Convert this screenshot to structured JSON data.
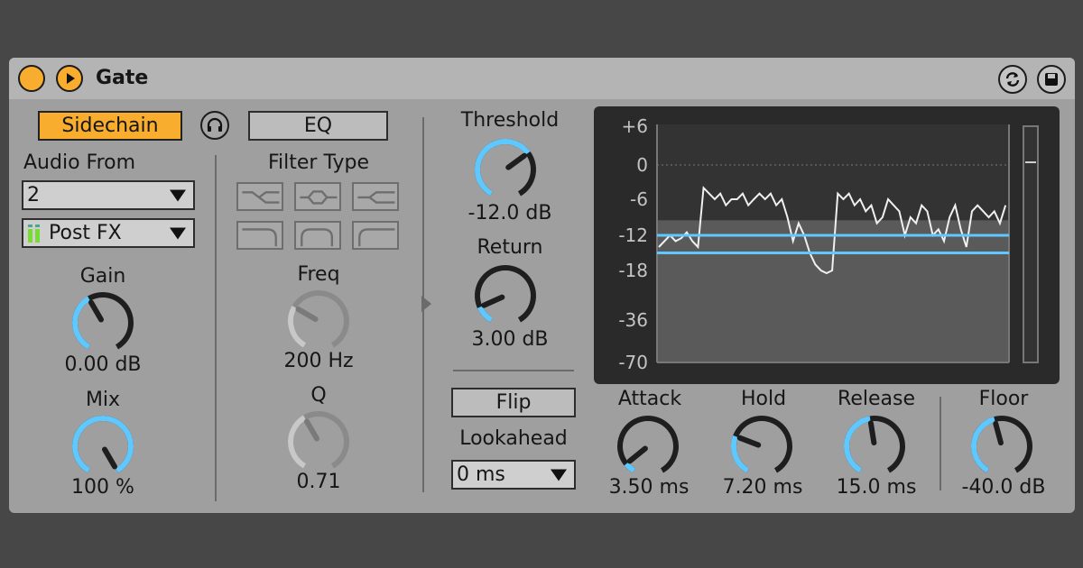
{
  "device": {
    "title": "Gate",
    "activator_icon": "power-circle",
    "play_icon": "play-triangle",
    "hot_swap_icon": "hot-swap-icon",
    "save_icon": "save-icon",
    "accent_color": "#f8ad2f",
    "knob_arc_color": "#5ec8ff"
  },
  "sidechain": {
    "toggle_label": "Sidechain",
    "listen_icon": "headphones-icon",
    "eq_label": "EQ",
    "audio_from_label": "Audio From",
    "audio_from_value": "2",
    "tap_value": "Post FX",
    "filter_type_label": "Filter Type",
    "filter_types": [
      "bandpass",
      "peak",
      "notch",
      "lowpass",
      "bandpass-round",
      "highpass"
    ],
    "gain": {
      "label": "Gain",
      "value": "0.00 dB",
      "level": 0.4
    },
    "mix": {
      "label": "Mix",
      "value": "100 %",
      "level": 1.0
    },
    "freq": {
      "label": "Freq",
      "value": "200 Hz",
      "level": 0.3
    },
    "q": {
      "label": "Q",
      "value": "0.71",
      "level": 0.4
    }
  },
  "controls": {
    "threshold": {
      "label": "Threshold",
      "value": "-12.0 dB",
      "level": 0.68
    },
    "return": {
      "label": "Return",
      "value": "3.00 dB",
      "level": 0.12
    },
    "flip_label": "Flip",
    "lookahead_label": "Lookahead",
    "lookahead_value": "0 ms",
    "attack": {
      "label": "Attack",
      "value": "3.50 ms",
      "level": 0.07
    },
    "hold": {
      "label": "Hold",
      "value": "7.20 ms",
      "level": 0.27
    },
    "release": {
      "label": "Release",
      "value": "15.0 ms",
      "level": 0.47
    },
    "floor": {
      "label": "Floor",
      "value": "-40.0 dB",
      "level": 0.45
    }
  },
  "display": {
    "ticks": [
      "+6",
      "0",
      "-6",
      "-12",
      "-18",
      "-36",
      "-70"
    ],
    "threshold_db": -12,
    "return_db": -15
  }
}
